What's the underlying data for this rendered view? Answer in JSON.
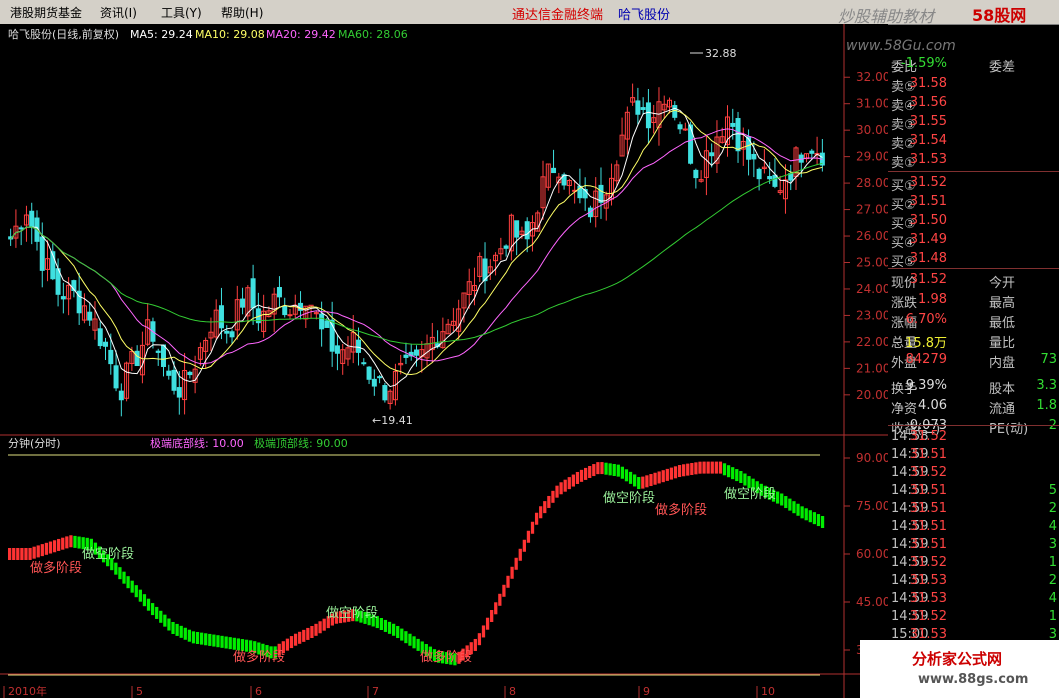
{
  "menu": {
    "items": [
      "港股期货基金",
      "资讯(I)",
      "工具(Y)",
      "帮助(H)"
    ],
    "title_a": "通达信金融终端",
    "title_b": "哈飞股份",
    "watermark_logo": "炒股辅助教材",
    "watermark_site": "58股网",
    "watermark_url": "www.58Gu.com"
  },
  "header": {
    "name": "哈飞股份(日线,前复权)",
    "ma5": "MA5: 29.24",
    "ma10": "MA10: 29.08",
    "ma20": "MA20: 29.42",
    "ma60": "MA60: 28.06",
    "high_marker": "32.88",
    "low_marker": "19.41",
    "sub_title": "分钟(分时)",
    "bottom_label": "极端底部线: 10.00",
    "top_label": "极端顶部线: 90.00"
  },
  "colors": {
    "up": "#ff4040",
    "down": "#3fe0e0",
    "ma5": "#ffffff",
    "ma10": "#ffff66",
    "ma20": "#ff66ff",
    "ma60": "#33cc33",
    "osc_up": "#ff3333",
    "osc_down": "#00ee00"
  },
  "chart_data": [
    {
      "type": "candlestick",
      "title": "哈飞股份(日线,前复权)",
      "yaxis_ticks": [
        "32.00",
        "31.00",
        "30.00",
        "29.00",
        "28.00",
        "27.00",
        "26.00",
        "25.00",
        "24.00",
        "23.00",
        "22.00",
        "21.00",
        "20.00"
      ],
      "ylim": [
        19.2,
        32.5
      ],
      "xaxis_ticks": [
        "2010年",
        "5",
        "6",
        "7",
        "8",
        "9",
        "10"
      ],
      "annotations": [
        {
          "text": "32.88",
          "type": "high"
        },
        {
          "text": "19.41",
          "type": "low"
        }
      ],
      "close_path": [
        25.9,
        27.1,
        25.2,
        23.9,
        23.8,
        23.2,
        21.9,
        20.2,
        21.4,
        22.6,
        20.6,
        20.2,
        21.5,
        23.0,
        22.4,
        23.8,
        22.9,
        23.6,
        23.3,
        23.9,
        22.2,
        21.6,
        22.0,
        20.8,
        20.2,
        20.8,
        21.1,
        22.1,
        22.8,
        23.6,
        24.7,
        25.1,
        26.3,
        25.6,
        27.8,
        28.9,
        27.6,
        26.9,
        27.8,
        29.5,
        31.1,
        30.5,
        31.6,
        30.1,
        28.4,
        29.6,
        30.6,
        29.2,
        28.3,
        27.7,
        28.6,
        29.6,
        29.2
      ],
      "ma_labels": [
        "MA5: 29.24",
        "MA10: 29.08",
        "MA20: 29.42",
        "MA60: 28.06"
      ]
    },
    {
      "type": "area",
      "title": "分钟(分时)",
      "yaxis_ticks": [
        "90.00",
        "75.00",
        "60.00",
        "45.00",
        "30.00"
      ],
      "ylim": [
        20,
        95
      ],
      "reference_lines": [
        {
          "label": "极端底部线",
          "value": 10.0
        },
        {
          "label": "极端顶部线",
          "value": 90.0
        }
      ],
      "path": [
        60,
        60,
        62,
        64,
        63,
        57,
        50,
        43,
        37,
        34,
        33,
        32,
        31,
        29,
        33,
        36,
        40,
        41,
        39,
        36,
        32,
        28,
        27,
        32,
        44,
        58,
        72,
        80,
        84,
        87,
        86,
        82,
        84,
        86,
        87,
        87,
        84,
        80,
        77,
        73,
        70
      ],
      "phase_labels": [
        {
          "text": "做多阶段",
          "kind": "long"
        },
        {
          "text": "做空阶段",
          "kind": "short"
        },
        {
          "text": "做多阶段",
          "kind": "long"
        },
        {
          "text": "做空阶段",
          "kind": "short"
        },
        {
          "text": "做多阶段",
          "kind": "long"
        },
        {
          "text": "做空阶段",
          "kind": "short"
        },
        {
          "text": "做多阶段",
          "kind": "long"
        },
        {
          "text": "做空阶段",
          "kind": "short"
        }
      ]
    }
  ],
  "quote": {
    "weibi": {
      "label": "委比",
      "value": "-1.59%",
      "label2": "委差"
    },
    "asks": [
      {
        "label": "卖⑤",
        "price": "31.58"
      },
      {
        "label": "卖④",
        "price": "31.56"
      },
      {
        "label": "卖③",
        "price": "31.55"
      },
      {
        "label": "卖②",
        "price": "31.54"
      },
      {
        "label": "卖①",
        "price": "31.53"
      }
    ],
    "bids": [
      {
        "label": "买①",
        "price": "31.52"
      },
      {
        "label": "买②",
        "price": "31.51"
      },
      {
        "label": "买③",
        "price": "31.50"
      },
      {
        "label": "买④",
        "price": "31.49"
      },
      {
        "label": "买⑤",
        "price": "31.48"
      }
    ],
    "stats": [
      {
        "label": "现价",
        "value": "31.52",
        "label2": "今开"
      },
      {
        "label": "涨跌",
        "value": "1.98",
        "label2": "最高"
      },
      {
        "label": "涨幅",
        "value": "6.70%",
        "label2": "最低"
      },
      {
        "label": "总量",
        "value": "15.8万",
        "label2": "量比"
      },
      {
        "label": "外盘",
        "value": "84279",
        "label2": "内盘",
        "value2": "73"
      },
      {
        "label": "换手",
        "value": "9.39%",
        "label2": "股本",
        "value2": "3.3"
      },
      {
        "label": "净资",
        "value": "4.06",
        "label2": "流通",
        "value2": "1.8"
      },
      {
        "label": "收益(二)",
        "value": "0.073",
        "label2": "PE(动)",
        "value2": "2"
      }
    ],
    "ticks": [
      {
        "time": "14:58",
        "price": "31.52"
      },
      {
        "time": "14:59",
        "price": "31.51"
      },
      {
        "time": "14:59",
        "price": "31.52"
      },
      {
        "time": "14:59",
        "price": "31.51",
        "vol": "5"
      },
      {
        "time": "14:59",
        "price": "31.51",
        "vol": "2"
      },
      {
        "time": "14:59",
        "price": "31.51",
        "vol": "4"
      },
      {
        "time": "14:59",
        "price": "31.51",
        "vol": "3"
      },
      {
        "time": "14:59",
        "price": "31.52",
        "vol": "1"
      },
      {
        "time": "14:59",
        "price": "31.53",
        "vol": "2"
      },
      {
        "time": "14:59",
        "price": "31.53",
        "vol": "4"
      },
      {
        "time": "14:59",
        "price": "31.52",
        "vol": "1"
      },
      {
        "time": "15:00",
        "price": "31.53",
        "vol": "3"
      }
    ]
  },
  "badge": {
    "text": "分析家公式网",
    "url": "www.88gs.com"
  }
}
